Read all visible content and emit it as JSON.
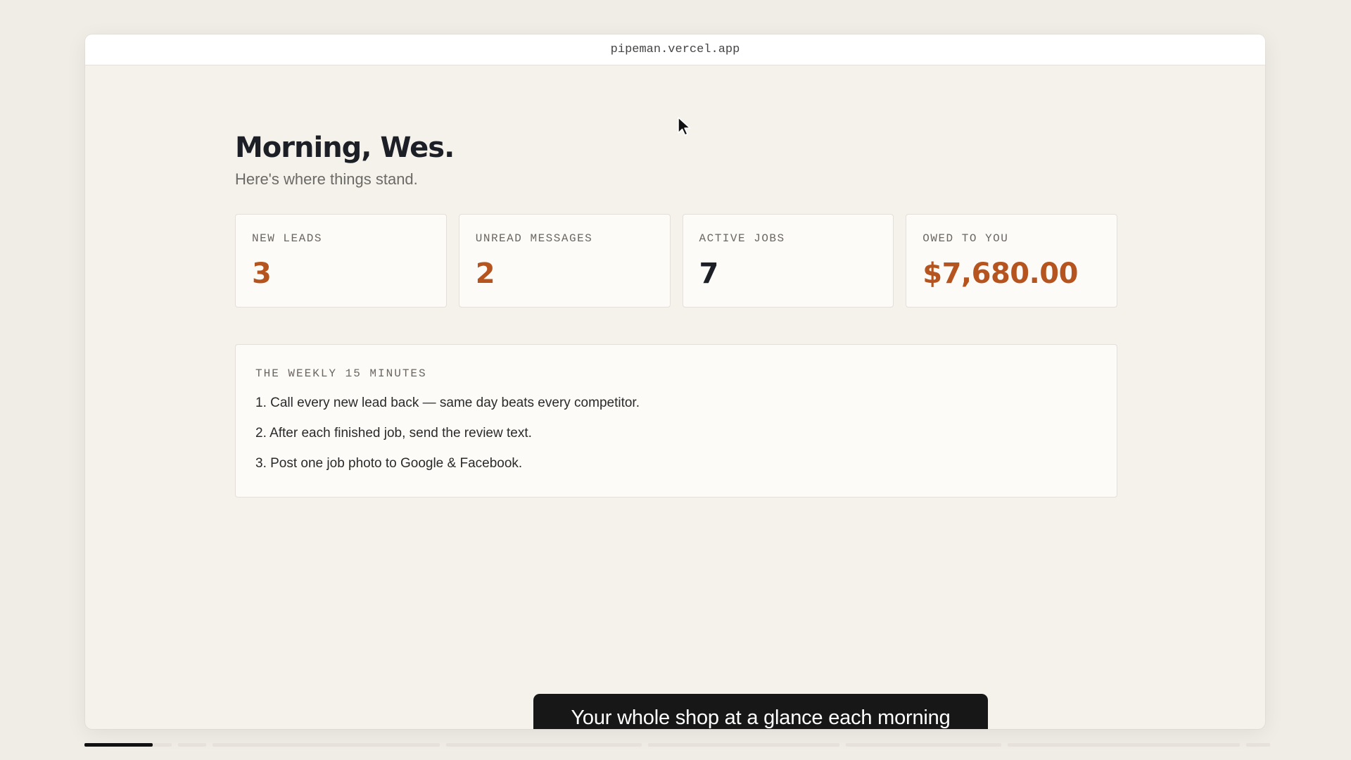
{
  "browser": {
    "url": "pipeman.vercel.app"
  },
  "header": {
    "greeting": "Morning, Wes.",
    "subtitle": "Here's where things stand."
  },
  "stats": [
    {
      "label": "NEW LEADS",
      "value": "3",
      "color": "#b5541f"
    },
    {
      "label": "UNREAD MESSAGES",
      "value": "2",
      "color": "#b5541f"
    },
    {
      "label": "ACTIVE JOBS",
      "value": "7",
      "color": "#1c1f26"
    },
    {
      "label": "OWED TO YOU",
      "value": "$7,680.00",
      "color": "#b5541f"
    }
  ],
  "weekly": {
    "title": "THE WEEKLY 15 MINUTES",
    "items": [
      "1. Call every new lead back — same day beats every competitor.",
      "2. After each finished job, send the review text.",
      "3. Post one job photo to Google & Facebook."
    ]
  },
  "caption": {
    "text": "Your whole shop at a glance each morning"
  },
  "progress": {
    "segments": 8,
    "current_segment": 1,
    "current_segment_fill": 0.78
  },
  "icons": {
    "cursor": "mouse-pointer-icon"
  }
}
